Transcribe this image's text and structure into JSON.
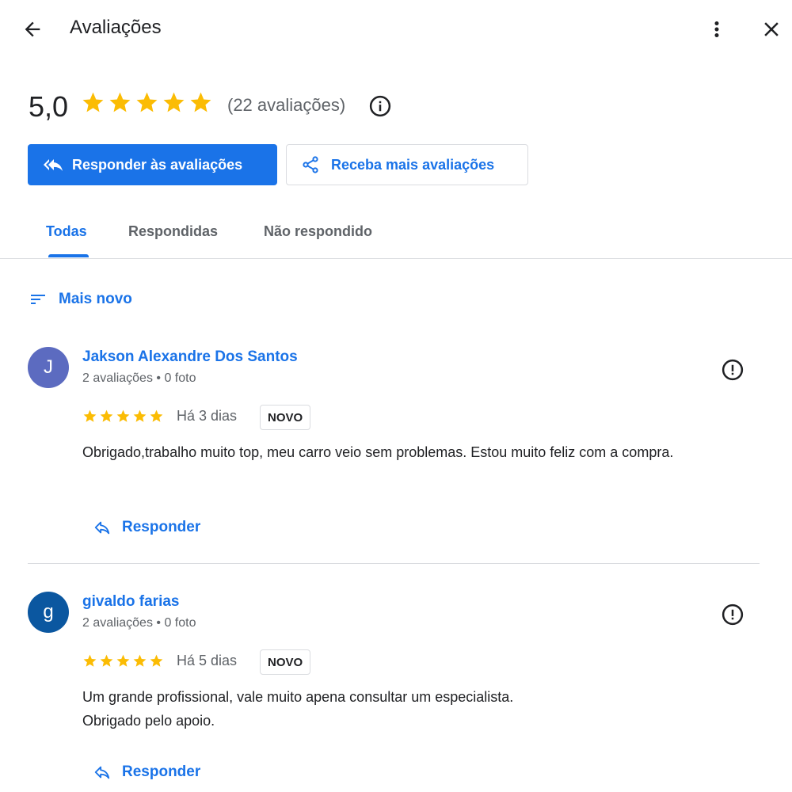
{
  "header": {
    "title": "Avaliações",
    "back_icon": "arrow-left-icon",
    "more_icon": "more-vert-icon",
    "close_icon": "close-icon"
  },
  "summary": {
    "average": "5,0",
    "stars": 5,
    "count_text": "(22 avaliações)",
    "star_color": "#fbbc04"
  },
  "actions": {
    "reply_label": "Responder às avaliações",
    "more_reviews_label": "Receba mais avaliações"
  },
  "tabs": [
    {
      "label": "Todas",
      "active": true
    },
    {
      "label": "Respondidas",
      "active": false
    },
    {
      "label": "Não respondido",
      "active": false
    }
  ],
  "sort": {
    "label": "Mais novo"
  },
  "reviews": [
    {
      "initial": "J",
      "avatar_color": "#5c6bc0",
      "name": "Jakson Alexandre Dos Santos",
      "meta": "2 avaliações • 0 foto",
      "rating": 5,
      "date": "Há 3 dias",
      "badge": "NOVO",
      "text": "Obrigado,trabalho muito top, meu carro veio sem problemas. Estou muito feliz com a compra.",
      "reply_label": "Responder"
    },
    {
      "initial": "g",
      "avatar_color": "#0b57a0",
      "name": "givaldo farias",
      "meta": "2 avaliações • 0 foto",
      "rating": 5,
      "date": "Há 5 dias",
      "badge": "NOVO",
      "text_line1": "Um grande profissional, vale muito apena consultar um especialista.",
      "text_line2": "Obrigado pelo apoio.",
      "reply_label": "Responder"
    }
  ],
  "colors": {
    "accent": "#1a73e8",
    "text_secondary": "#5f6368",
    "divider": "#dadce0"
  }
}
